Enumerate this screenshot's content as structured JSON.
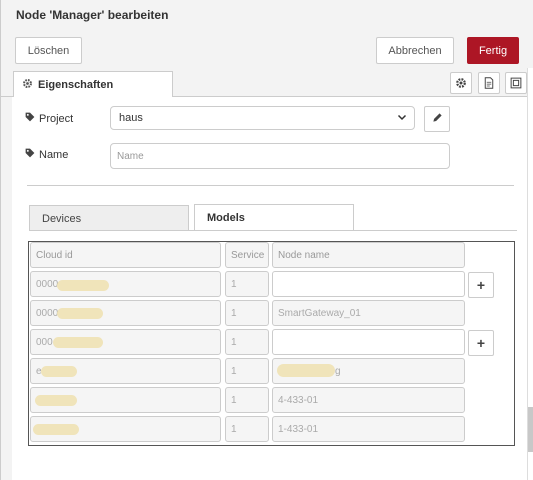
{
  "dialog": {
    "title": "Node 'Manager' bearbeiten"
  },
  "toolbar": {
    "delete_label": "Löschen",
    "cancel_label": "Abbrechen",
    "done_label": "Fertig"
  },
  "tabs": {
    "properties_label": "Eigenschaften",
    "icons": [
      "gear-icon",
      "description-icon",
      "appearance-icon"
    ]
  },
  "form": {
    "project": {
      "label": "Project",
      "value": "haus"
    },
    "name": {
      "label": "Name",
      "placeholder": "Name"
    }
  },
  "subtabs": {
    "devices_label": "Devices",
    "models_label": "Models",
    "active": "Models"
  },
  "table": {
    "headers": {
      "cloud_id": "Cloud id",
      "service": "Service",
      "node_name": "Node name"
    },
    "rows": [
      {
        "cloud_id": "0000",
        "service": "1",
        "node_name": "",
        "has_add_button": true
      },
      {
        "cloud_id": "0000",
        "service": "1",
        "node_name": "SmartGateway_01",
        "has_add_button": false
      },
      {
        "cloud_id": "000",
        "service": "1",
        "node_name": "",
        "has_add_button": true
      },
      {
        "cloud_id": "e",
        "service": "1",
        "node_name": "g",
        "has_add_button": false
      },
      {
        "cloud_id": "",
        "service": "1",
        "node_name": "4-433-01",
        "has_add_button": false
      },
      {
        "cloud_id": "",
        "service": "1",
        "node_name": "1-433-01",
        "has_add_button": false
      }
    ]
  },
  "colors": {
    "accent": "#ad1625",
    "redaction": "#efe2b4"
  }
}
